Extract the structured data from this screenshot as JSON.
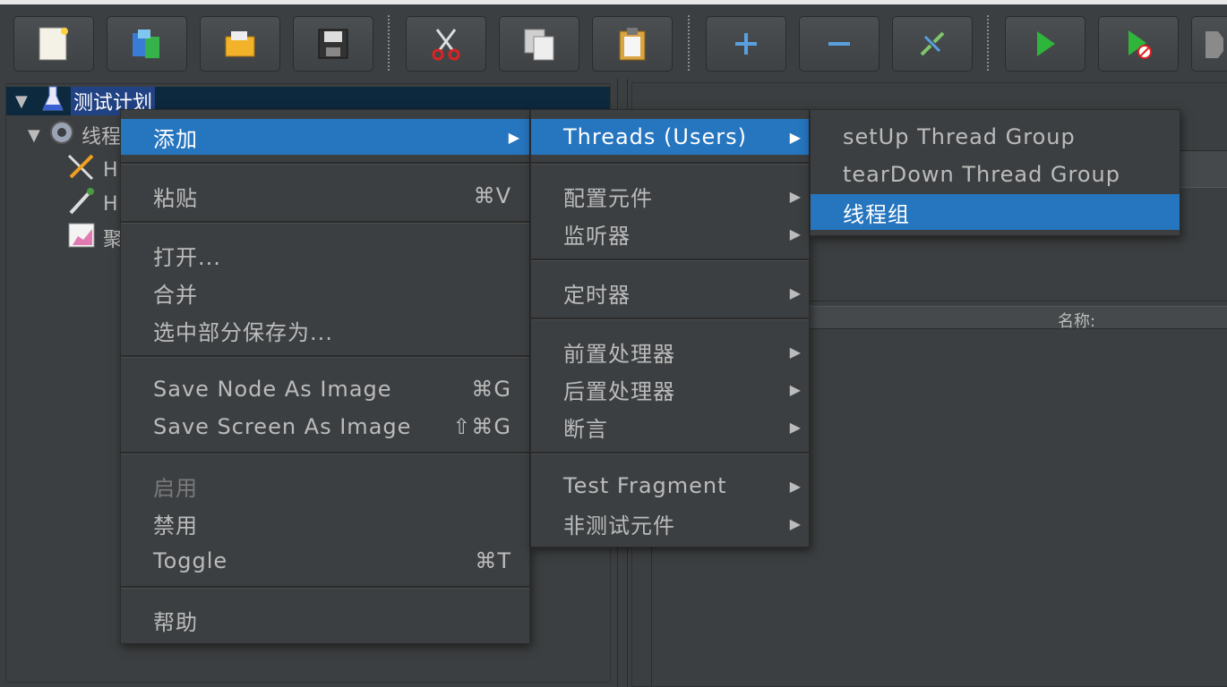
{
  "toolbar": {
    "icons": [
      "new-icon",
      "templates-icon",
      "open-icon",
      "save-icon",
      "cut-icon",
      "copy-icon",
      "paste-icon",
      "expand-icon",
      "collapse-icon",
      "toggle-icon",
      "start-icon",
      "start-no-pause-icon",
      "stop-icon"
    ]
  },
  "tree": {
    "items": [
      {
        "label": "测试计划"
      },
      {
        "label": "线程"
      },
      {
        "label": "H"
      },
      {
        "label": "H"
      },
      {
        "label": "聚"
      }
    ]
  },
  "right_panel": {
    "name_label": "名称:"
  },
  "context_menu": {
    "items": [
      {
        "label": "添加"
      },
      {
        "label": "粘贴",
        "shortcut": "⌘V"
      },
      {
        "label": "打开..."
      },
      {
        "label": "合并"
      },
      {
        "label": "选中部分保存为..."
      },
      {
        "label": "Save Node As Image",
        "shortcut": "⌘G"
      },
      {
        "label": "Save Screen As Image",
        "shortcut": "⇧⌘G"
      },
      {
        "label": "启用"
      },
      {
        "label": "禁用"
      },
      {
        "label": "Toggle",
        "shortcut": "⌘T"
      },
      {
        "label": "帮助"
      }
    ]
  },
  "add_submenu": {
    "items": [
      {
        "label": "Threads (Users)"
      },
      {
        "label": "配置元件"
      },
      {
        "label": "监听器"
      },
      {
        "label": "定时器"
      },
      {
        "label": "前置处理器"
      },
      {
        "label": "后置处理器"
      },
      {
        "label": "断言"
      },
      {
        "label": "Test Fragment"
      },
      {
        "label": "非测试元件"
      }
    ]
  },
  "threads_submenu": {
    "items": [
      {
        "label": "setUp Thread Group"
      },
      {
        "label": "tearDown Thread Group"
      },
      {
        "label": "线程组"
      }
    ]
  },
  "colors": {
    "background": "#3c3f41",
    "highlight": "#2675bf",
    "tree_selection": "#214283",
    "text": "#bbbbbb"
  }
}
